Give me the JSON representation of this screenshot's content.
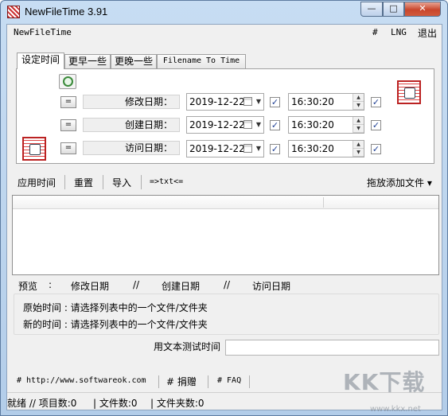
{
  "window": {
    "title": "NewFileTime 3.91",
    "min_glyph": "—",
    "max_glyph": "□",
    "close_glyph": "✕"
  },
  "menu": {
    "app": "NewFileTime",
    "hash": "#",
    "lng": "LNG",
    "exit": "退出"
  },
  "tabs": [
    "设定时间",
    "更早一些",
    "更晚一些",
    "Filename To Time"
  ],
  "rows": [
    {
      "btn": "=",
      "label": "修改日期：",
      "date": "2019-12-22",
      "date_checked": true,
      "time": "16:30:20",
      "time_checked": true
    },
    {
      "btn": "=",
      "label": "创建日期：",
      "date": "2019-12-22",
      "date_checked": true,
      "time": "16:30:20",
      "time_checked": true
    },
    {
      "btn": "=",
      "label": "访问日期：",
      "date": "2019-12-22",
      "date_checked": true,
      "time": "16:30:20",
      "time_checked": true
    }
  ],
  "check_mark": "✓",
  "spin_up": "▲",
  "spin_down": "▼",
  "toolbar": {
    "apply": "应用时间",
    "reset": "重置",
    "import": "导入",
    "txt": "=>txt<=",
    "drop": "拖放添加文件 ▾"
  },
  "preview": {
    "label": "预览",
    "colon": ":",
    "modified": "修改日期",
    "sep1": "//",
    "created": "创建日期",
    "sep2": "//",
    "accessed": "访问日期"
  },
  "info": {
    "original": "原始时间 : 请选择列表中的一个文件/文件夹",
    "new": "新的时间 : 请选择列表中的一个文件/文件夹"
  },
  "test": {
    "label": "用文本测试时间",
    "value": ""
  },
  "footer": {
    "site": "# http://www.softwareok.com",
    "donate": "# 捐赠",
    "faq": "# FAQ"
  },
  "status": {
    "ready": "就绪 // 项目数:0",
    "files": "| 文件数:0",
    "folders": "| 文件夹数:0"
  },
  "watermark": {
    "text": "KK下载",
    "url": "www.kkx.net"
  }
}
